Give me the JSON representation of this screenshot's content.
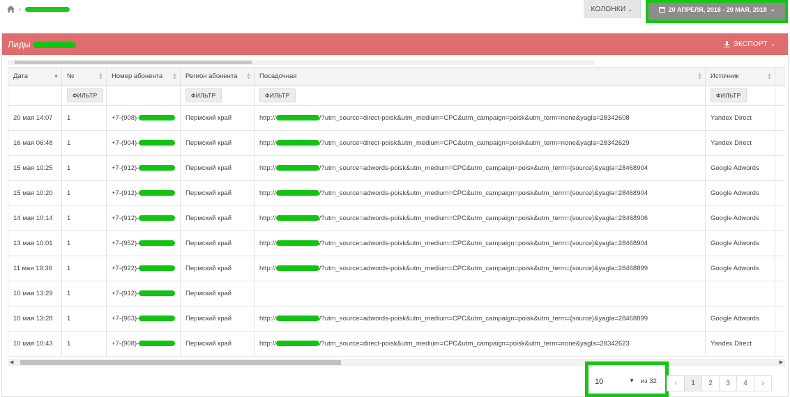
{
  "topbar": {
    "columns_label": "КОЛОНКИ",
    "date_range": "20 АПРЕЛЯ, 2018 - 20 МАЯ, 2018"
  },
  "panel": {
    "title": "Лиды",
    "export_label": "ЭКСПОРТ"
  },
  "table": {
    "columns": [
      "Дата",
      "№",
      "Номер абонента",
      "Регион абонента",
      "Посадочная",
      "Источник"
    ],
    "filter_label": "ФИЛЬТР",
    "rows": [
      {
        "date": "20 мая 14:07",
        "num": "1",
        "phone": "+7-(908)-",
        "region": "Пермский край",
        "landing_prefix": "http://",
        "landing": "/?utm_source=direct-poisk&utm_medium=CPC&utm_campaign=poisk&utm_term=none&yagla=28342608",
        "source": "Yandex Direct"
      },
      {
        "date": "16 мая 06:48",
        "num": "1",
        "phone": "+7-(904)-",
        "region": "Пермский край",
        "landing_prefix": "http://",
        "landing": "/?utm_source=direct-poisk&utm_medium=CPC&utm_campaign=poisk&utm_term=none&yagla=28342629",
        "source": "Yandex Direct"
      },
      {
        "date": "15 мая 10:25",
        "num": "1",
        "phone": "+7-(912)-",
        "region": "Пермский край",
        "landing_prefix": "http://",
        "landing": "/?utm_source=adwords-poisk&utm_medium=CPC&utm_campaign=poisk&utm_term={source}&yagla=28468904",
        "source": "Google Adwords"
      },
      {
        "date": "15 мая 10:20",
        "num": "1",
        "phone": "+7-(912)-",
        "region": "Пермский край",
        "landing_prefix": "http://",
        "landing": "/?utm_source=adwords-poisk&utm_medium=CPC&utm_campaign=poisk&utm_term={source}&yagla=28468904",
        "source": "Google Adwords"
      },
      {
        "date": "14 мая 10:14",
        "num": "1",
        "phone": "+7-(912)-",
        "region": "Пермский край",
        "landing_prefix": "http://",
        "landing": "/?utm_source=adwords-poisk&utm_medium=CPC&utm_campaign=poisk&utm_term={source}&yagla=28468906",
        "source": "Google Adwords"
      },
      {
        "date": "13 мая 10:01",
        "num": "1",
        "phone": "+7-(952)-",
        "region": "Пермский край",
        "landing_prefix": "http://",
        "landing": "/?utm_source=adwords-poisk&utm_medium=CPC&utm_campaign=poisk&utm_term={source}&yagla=28468904",
        "source": "Google Adwords"
      },
      {
        "date": "11 мая 19:36",
        "num": "1",
        "phone": "+7-(922)-",
        "region": "Пермский край",
        "landing_prefix": "http://",
        "landing": "/?utm_source=adwords-poisk&utm_medium=CPC&utm_campaign=poisk&utm_term={source}&yagla=28468899",
        "source": "Google Adwords"
      },
      {
        "date": "10 мая 13:29",
        "num": "1",
        "phone": "+7-(912)-",
        "region": "Пермский край",
        "landing_prefix": "",
        "landing": "",
        "source": ""
      },
      {
        "date": "10 мая 13:28",
        "num": "1",
        "phone": "+7-(963)-",
        "region": "Пермский край",
        "landing_prefix": "http://",
        "landing": "/?utm_source=adwords-poisk&utm_medium=CPC&utm_campaign=poisk&utm_term={source}&yagla=28468899",
        "source": "Google Adwords"
      },
      {
        "date": "10 мая 10:43",
        "num": "1",
        "phone": "+7-(908)-",
        "region": "Пермский край",
        "landing_prefix": "http://",
        "landing": "/?utm_source=direct-poisk&utm_medium=CPC&utm_campaign=poisk&utm_term=none&yagla=28342623",
        "source": "Yandex Direct"
      }
    ]
  },
  "pagination": {
    "page_size": "10",
    "of_label": "из 32",
    "pages": [
      "1",
      "2",
      "3",
      "4"
    ],
    "current": "1"
  },
  "colors": {
    "header_red": "#e06d6d",
    "highlight_green": "#16c516",
    "link_blue": "#2b6cb5"
  }
}
